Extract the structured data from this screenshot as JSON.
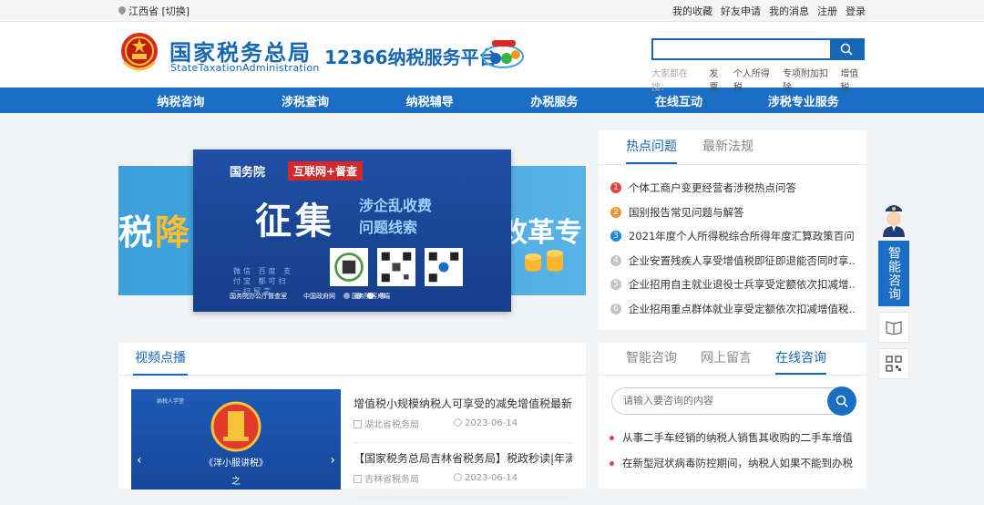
{
  "topbar": {
    "location": "江西省 [切换]",
    "links": [
      "我的收藏",
      "好友申请",
      "我的消息",
      "注册",
      "登录"
    ]
  },
  "header": {
    "logo_cn": "国家税务总局",
    "logo_en": "StateTaxationAdministration",
    "platform": "12366纳税服务平台",
    "search_placeholder": "",
    "hot_label": "大家都在搜：",
    "hot_keywords": [
      "发票",
      "个人所得税",
      "专项附加扣除",
      "增值税"
    ]
  },
  "nav": [
    "纳税咨询",
    "涉税查询",
    "纳税辅导",
    "办税服务",
    "在线互动",
    "涉税专业服务"
  ],
  "carousel": {
    "bg_left_a": "税",
    "bg_left_b": "降",
    "bg_right": "改革专",
    "slide_tag1": "国务院",
    "slide_tag2": "互联网+督查",
    "slide_big": "征集",
    "slide_sub1": "涉企乱收费",
    "slide_sub2": "问题线索",
    "slide_caption": "微信 百度 支付宝 都可扫一扫留言",
    "slide_foot": [
      "国务院办公厅督查室",
      "中国政府网",
      "国务院客户端"
    ],
    "active_dot": 3
  },
  "hot_panel": {
    "tabs": [
      "热点问题",
      "最新法规"
    ],
    "active_tab": 0,
    "items": [
      {
        "n": "1",
        "text": "个体工商户变更经营者涉税热点问答",
        "color": "#e64340"
      },
      {
        "n": "2",
        "text": "国别报告常见问题与解答",
        "color": "#f5922f"
      },
      {
        "n": "3",
        "text": "2021年度个人所得税综合所得年度汇算政策百问...",
        "color": "#1a8ad8"
      },
      {
        "n": "4",
        "text": "企业安置残疾人享受增值税即征即退能否同时享...",
        "color": "#c4c4c4"
      },
      {
        "n": "5",
        "text": "企业招用自主就业退役士兵享受定额依次扣减增...",
        "color": "#c4c4c4"
      },
      {
        "n": "6",
        "text": "企业招用重点群体就业享受定额依次扣减增值税...",
        "color": "#c4c4c4"
      }
    ]
  },
  "video_panel": {
    "title": "视频点播",
    "thumb_small": "纳税人学堂",
    "thumb_caption": "《洋小服讲税》",
    "thumb_caption2": "之",
    "items": [
      {
        "title": "增值税小规模纳税人可享受的减免增值税最新...",
        "source": "湖北省税务局",
        "date": "2023-06-14"
      },
      {
        "title": "【国家税务总局吉林省税务局】税政秒读|年满6...",
        "source": "吉林省税务局",
        "date": "2023-06-14"
      }
    ]
  },
  "consult_panel": {
    "tabs": [
      "智能咨询",
      "网上留言",
      "在线咨询"
    ],
    "active_tab": 2,
    "placeholder": "请输入要咨询的内容",
    "items": [
      "从事二手车经销的纳税人销售其收购的二手车增值...",
      "在新型冠状病毒防控期间，纳税人如果不能到办税..."
    ]
  },
  "side_float": {
    "label": "智能咨询"
  },
  "colors": {
    "brand": "#1767b7",
    "nav": "#1a6fc4",
    "accent_red": "#e64340"
  }
}
